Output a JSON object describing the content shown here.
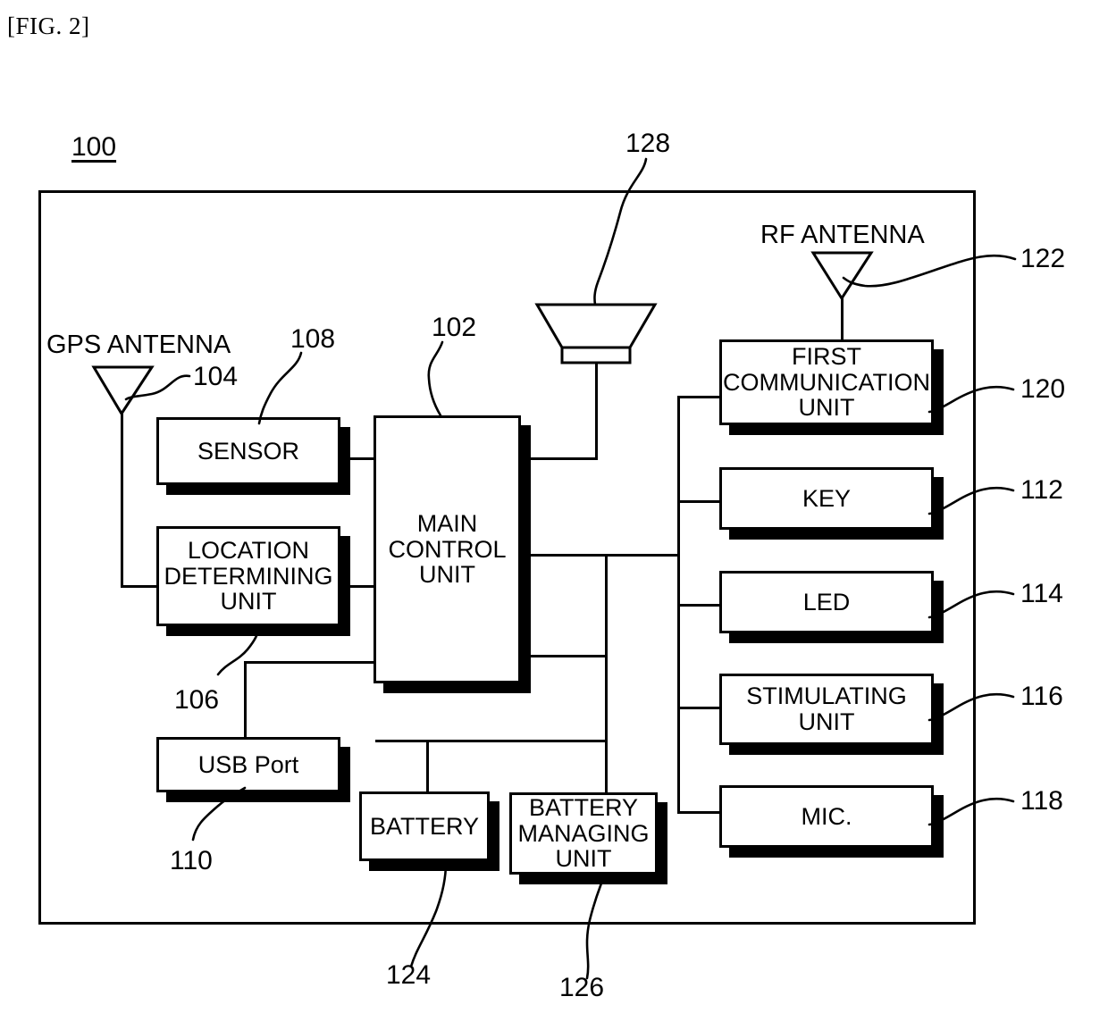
{
  "figure": {
    "label": "[FIG. 2]",
    "system_ref": "100"
  },
  "captions": {
    "gps_antenna": "GPS ANTENNA",
    "rf_antenna": "RF ANTENNA"
  },
  "blocks": {
    "sensor": {
      "label": "SENSOR",
      "ref": "108"
    },
    "location_determining_unit": {
      "label": "LOCATION\nDETERMINING\nUNIT",
      "ref": "106"
    },
    "usb_port": {
      "label": "USB Port",
      "ref": "110"
    },
    "main_control_unit": {
      "label": "MAIN\nCONTROL\nUNIT",
      "ref": "102"
    },
    "battery": {
      "label": "BATTERY",
      "ref": "124"
    },
    "battery_managing_unit": {
      "label": "BATTERY\nMANAGING\nUNIT",
      "ref": "126"
    },
    "first_communication_unit": {
      "label": "FIRST\nCOMMUNICATION\nUNIT",
      "ref": "120"
    },
    "key": {
      "label": "KEY",
      "ref": "112"
    },
    "led": {
      "label": "LED",
      "ref": "114"
    },
    "stimulating_unit": {
      "label": "STIMULATING\nUNIT",
      "ref": "116"
    },
    "mic": {
      "label": "MIC.",
      "ref": "118"
    }
  },
  "symbols": {
    "gps_antenna_ref": "104",
    "rf_antenna_ref": "122",
    "speaker_ref": "128"
  },
  "colors": {
    "line": "#000000",
    "background": "#ffffff",
    "shadow": "#000000"
  }
}
